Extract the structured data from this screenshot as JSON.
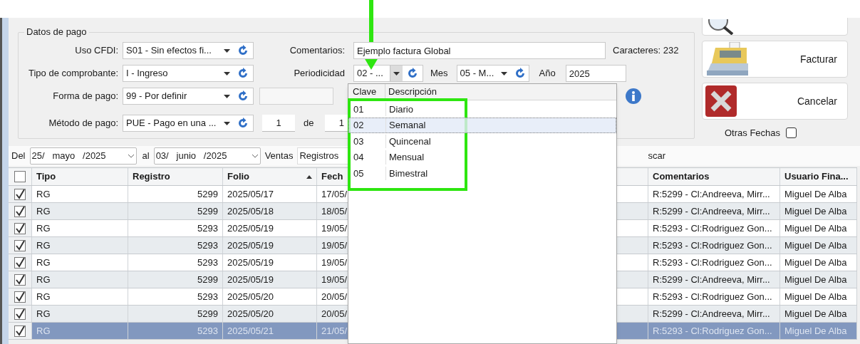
{
  "payment_group": {
    "title": "Datos de pago",
    "uso_cfdi": {
      "label": "Uso CFDI:",
      "value": "S01 - Sin efectos fi..."
    },
    "tipo_comprobante": {
      "label": "Tipo de comprobante:",
      "value": "I - Ingreso"
    },
    "forma_pago": {
      "label": "Forma de pago:",
      "value": "99 - Por definir"
    },
    "metodo_pago": {
      "label": "Método de pago:",
      "value": "PUE - Pago en una ..."
    },
    "parcialidad": {
      "value": "1",
      "of_label": "de",
      "total": "1"
    },
    "comentarios": {
      "label": "Comentarios:",
      "value": "Ejemplo factura Global"
    },
    "caracteres": "Caracteres: 232",
    "periodicidad": {
      "label": "Periodicidad",
      "value": "02 - ...",
      "open": true
    },
    "mes": {
      "label": "Mes",
      "value": "05 - M..."
    },
    "anio": {
      "label": "Año",
      "value": "2025"
    }
  },
  "actions": [
    {
      "kind": "preview"
    },
    {
      "kind": "register",
      "label": "Facturar"
    },
    {
      "kind": "cancel",
      "label": "Cancelar"
    }
  ],
  "otras_fechas": {
    "label": "Otras Fechas",
    "checked": false
  },
  "filter_bar": {
    "from_label": "Del",
    "from": "25/   mayo   /2025",
    "to_label": "al",
    "to": "03/   junio   /2025",
    "ventas_label": "Ventas",
    "ventas": "Registros",
    "search_fragment": "scar"
  },
  "grid": {
    "all_checked": false,
    "columns": [
      {
        "label": "Tipo",
        "sorted": false
      },
      {
        "label": "Registro",
        "sorted": false
      },
      {
        "label": "Folio",
        "sorted": true
      },
      {
        "label": "Fech",
        "sorted": false
      },
      {
        "label": "Comentarios",
        "sorted": false
      },
      {
        "label": "Usuario Fina...",
        "sorted": false
      }
    ],
    "rows": [
      {
        "checked": true,
        "selected": false,
        "tipo": "RG",
        "registro": "5299",
        "folio": "2025/05/17",
        "fecha": "17/05/",
        "comentarios": "R:5299 - Cl:Andreeva, Mirr...",
        "usuario": "Miguel De Alba"
      },
      {
        "checked": true,
        "selected": false,
        "tipo": "RG",
        "registro": "5299",
        "folio": "2025/05/18",
        "fecha": "18/05/",
        "comentarios": "R:5299 - Cl:Andreeva, Mirr...",
        "usuario": "Miguel De Alba"
      },
      {
        "checked": true,
        "selected": false,
        "tipo": "RG",
        "registro": "5293",
        "folio": "2025/05/19",
        "fecha": "19/05/",
        "comentarios": "R:5293 - Cl:Rodriguez Gon...",
        "usuario": "Miguel De Alba"
      },
      {
        "checked": true,
        "selected": false,
        "tipo": "RG",
        "registro": "5293",
        "folio": "2025/05/19",
        "fecha": "19/05/",
        "comentarios": "R:5293 - Cl:Rodriguez Gon...",
        "usuario": "Miguel De Alba"
      },
      {
        "checked": true,
        "selected": false,
        "tipo": "RG",
        "registro": "5293",
        "folio": "2025/05/19",
        "fecha": "19/05/",
        "comentarios": "R:5293 - Cl:Rodriguez Gon...",
        "usuario": "Miguel De Alba"
      },
      {
        "checked": true,
        "selected": false,
        "tipo": "RG",
        "registro": "5299",
        "folio": "2025/05/19",
        "fecha": "19/05/",
        "comentarios": "R:5299 - Cl:Andreeva, Mirr...",
        "usuario": "Miguel De Alba"
      },
      {
        "checked": true,
        "selected": false,
        "tipo": "RG",
        "registro": "5293",
        "folio": "2025/05/20",
        "fecha": "20/05/",
        "comentarios": "R:5293 - Cl:Rodriguez Gon...",
        "usuario": "Miguel De Alba"
      },
      {
        "checked": true,
        "selected": false,
        "tipo": "RG",
        "registro": "5299",
        "folio": "2025/05/20",
        "fecha": "20/05/",
        "comentarios": "R:5299 - Cl:Andreeva, Mirr...",
        "usuario": "Miguel De Alba"
      },
      {
        "checked": true,
        "selected": true,
        "tipo": "RG",
        "registro": "5293",
        "folio": "2025/05/21",
        "fecha": "21/05/",
        "comentarios": "R:5293 - Cl:Rodriguez Gon...",
        "usuario": "Miguel De Alba"
      }
    ]
  },
  "dropdown": {
    "columns": [
      "Clave",
      "Descripción"
    ],
    "items": [
      {
        "clave": "01",
        "descripcion": "Diario",
        "selected": false
      },
      {
        "clave": "02",
        "descripcion": "Semanal",
        "selected": true
      },
      {
        "clave": "03",
        "descripcion": "Quincenal",
        "selected": false
      },
      {
        "clave": "04",
        "descripcion": "Mensual",
        "selected": false
      },
      {
        "clave": "05",
        "descripcion": "Bimestral",
        "selected": false
      }
    ]
  }
}
